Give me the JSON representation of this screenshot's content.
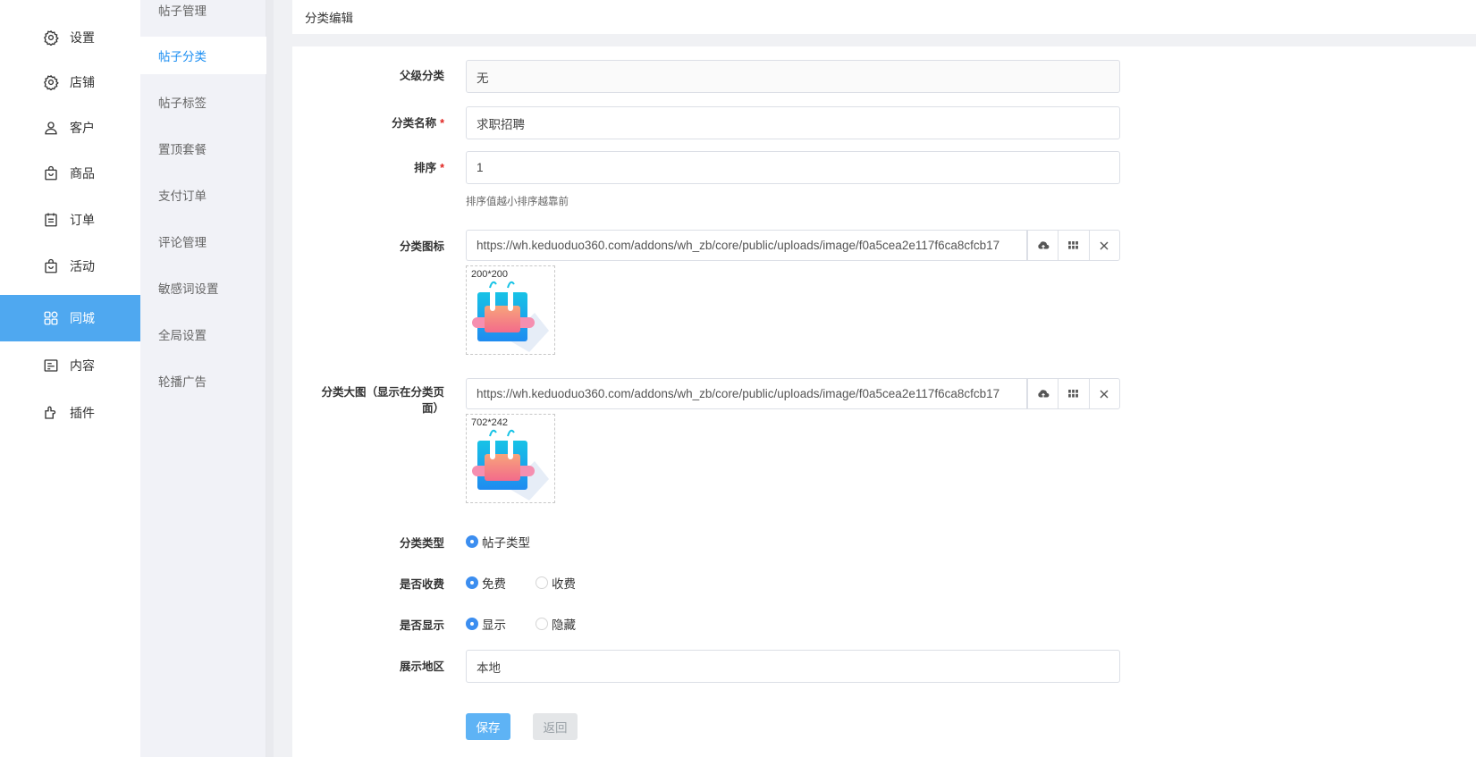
{
  "sidebar": {
    "items": [
      {
        "label": "设置",
        "icon": "gear-icon"
      },
      {
        "label": "店铺",
        "icon": "shop-gear-icon"
      },
      {
        "label": "客户",
        "icon": "user-icon"
      },
      {
        "label": "商品",
        "icon": "bag-icon"
      },
      {
        "label": "订单",
        "icon": "order-icon"
      },
      {
        "label": "活动",
        "icon": "activity-bag-icon"
      },
      {
        "label": "同城",
        "icon": "grid-apps-icon",
        "active": true
      },
      {
        "label": "内容",
        "icon": "content-icon"
      },
      {
        "label": "插件",
        "icon": "plugin-icon"
      }
    ],
    "accent": "#4fa8f0"
  },
  "subbar": {
    "items": [
      {
        "label": "帖子管理"
      },
      {
        "label": "帖子分类",
        "active": true
      },
      {
        "label": "帖子标签"
      },
      {
        "label": "置顶套餐"
      },
      {
        "label": "支付订单"
      },
      {
        "label": "评论管理"
      },
      {
        "label": "敏感词设置"
      },
      {
        "label": "全局设置"
      },
      {
        "label": "轮播广告"
      }
    ]
  },
  "header": {
    "title": "分类编辑"
  },
  "form": {
    "parent": {
      "label": "父级分类",
      "value": "无"
    },
    "name": {
      "label": "分类名称",
      "required": "*",
      "value": "求职招聘"
    },
    "sort": {
      "label": "排序",
      "required": "*",
      "value": "1",
      "help": "排序值越小排序越靠前"
    },
    "icon": {
      "label": "分类图标",
      "url": "https://wh.keduoduo360.com/addons/wh_zb/core/public/uploads/image/f0a5cea2e117f6ca8cfcb17",
      "size": "200*200"
    },
    "banner": {
      "label_line1": "分类大图（显示在分类页",
      "label_line2": "面）",
      "url": "https://wh.keduoduo360.com/addons/wh_zb/core/public/uploads/image/f0a5cea2e117f6ca8cfcb17",
      "size": "702*242"
    },
    "type": {
      "label": "分类类型",
      "options": [
        "帖子类型"
      ]
    },
    "fee": {
      "label": "是否收费",
      "options": [
        "免费",
        "收费"
      ]
    },
    "display": {
      "label": "是否显示",
      "options": [
        "显示",
        "隐藏"
      ]
    },
    "region": {
      "label": "展示地区",
      "value": "本地"
    },
    "buttons": {
      "save": "保存",
      "back": "返回"
    }
  }
}
